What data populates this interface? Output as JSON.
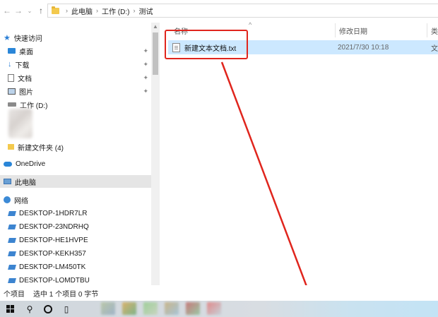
{
  "breadcrumb": [
    "此电脑",
    "工作 (D:)",
    "测试"
  ],
  "nav": {
    "quick_access": "快速访问",
    "items": [
      {
        "label": "桌面",
        "icon": "desktop-icon"
      },
      {
        "label": "下载",
        "icon": "download-icon"
      },
      {
        "label": "文档",
        "icon": "document-icon"
      },
      {
        "label": "图片",
        "icon": "pictures-icon"
      },
      {
        "label": "工作 (D:)",
        "icon": "drive-icon"
      }
    ],
    "new_folder": "新建文件夹 (4)",
    "onedrive": "OneDrive",
    "this_pc": "此电脑",
    "network": "网络",
    "hosts": [
      "DESKTOP-1HDR7LR",
      "DESKTOP-23NDRHQ",
      "DESKTOP-HE1HVPE",
      "DESKTOP-KEKH357",
      "DESKTOP-LM450TK",
      "DESKTOP-LOMDTBU"
    ]
  },
  "columns": {
    "name": "名称",
    "date": "修改日期",
    "type_partial": "类"
  },
  "file": {
    "name": "新建文本文档.txt",
    "date": "2021/7/30 10:18",
    "type_partial": "文"
  },
  "status": {
    "count": "个项目",
    "selection": "选中 1 个项目 0 字节"
  },
  "colors": {
    "selection": "#cce8ff",
    "annotation": "#e0251d",
    "accent": "#2a7fd6"
  }
}
